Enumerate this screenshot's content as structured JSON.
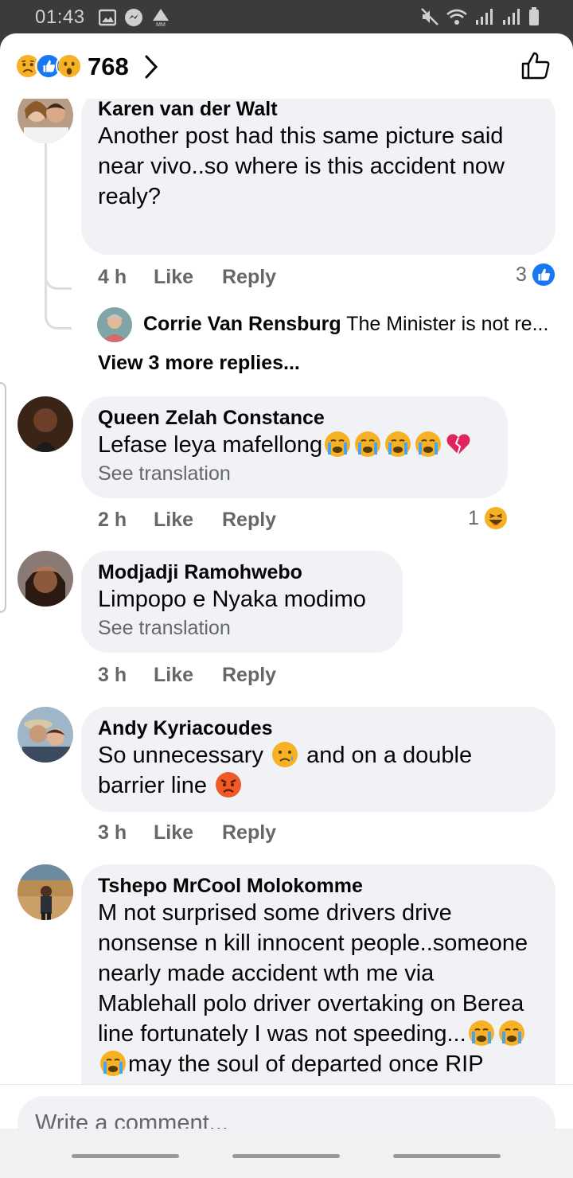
{
  "status": {
    "time": "01:43"
  },
  "header": {
    "reaction_count": "768"
  },
  "comments": [
    {
      "name": "Karen van der Walt",
      "text": "Another post had this same picture said near vivo..so where is this accident now realy?",
      "time": "4 h",
      "like": "Like",
      "reply": "Reply",
      "reaction_count": "3"
    },
    {
      "name": "Queen Zelah Constance",
      "text": "Lefase leya mafellong",
      "see_translation": "See translation",
      "time": "2 h",
      "like": "Like",
      "reply": "Reply",
      "reaction_count": "1"
    },
    {
      "name": "Modjadji Ramohwebo",
      "text": "Limpopo e Nyaka modimo",
      "see_translation": "See translation",
      "time": "3 h",
      "like": "Like",
      "reply": "Reply"
    },
    {
      "name": "Andy Kyriacoudes",
      "text_a": "So unnecessary",
      "text_b": "and on a double",
      "text_c": "barrier line",
      "time": "3 h",
      "like": "Like",
      "reply": "Reply"
    },
    {
      "name": "Tshepo MrCool Molokomme",
      "text_a": "M not surprised some drivers drive nonsense n kill innocent people..someone nearly made accident wth me via Mablehall polo driver overtaking on Berea line fortunately I was not speeding...",
      "text_b": "may the soul of departed once RIP"
    }
  ],
  "reply_preview": {
    "name": "Corrie Van Rensburg",
    "text": "The Minister is not re..."
  },
  "view_more": "View 3 more replies...",
  "composer": {
    "placeholder": "Write a comment..."
  },
  "colors": {
    "fb_blue": "#1877f2",
    "bubble": "#f0f2f5",
    "secondary_text": "#65676b"
  }
}
